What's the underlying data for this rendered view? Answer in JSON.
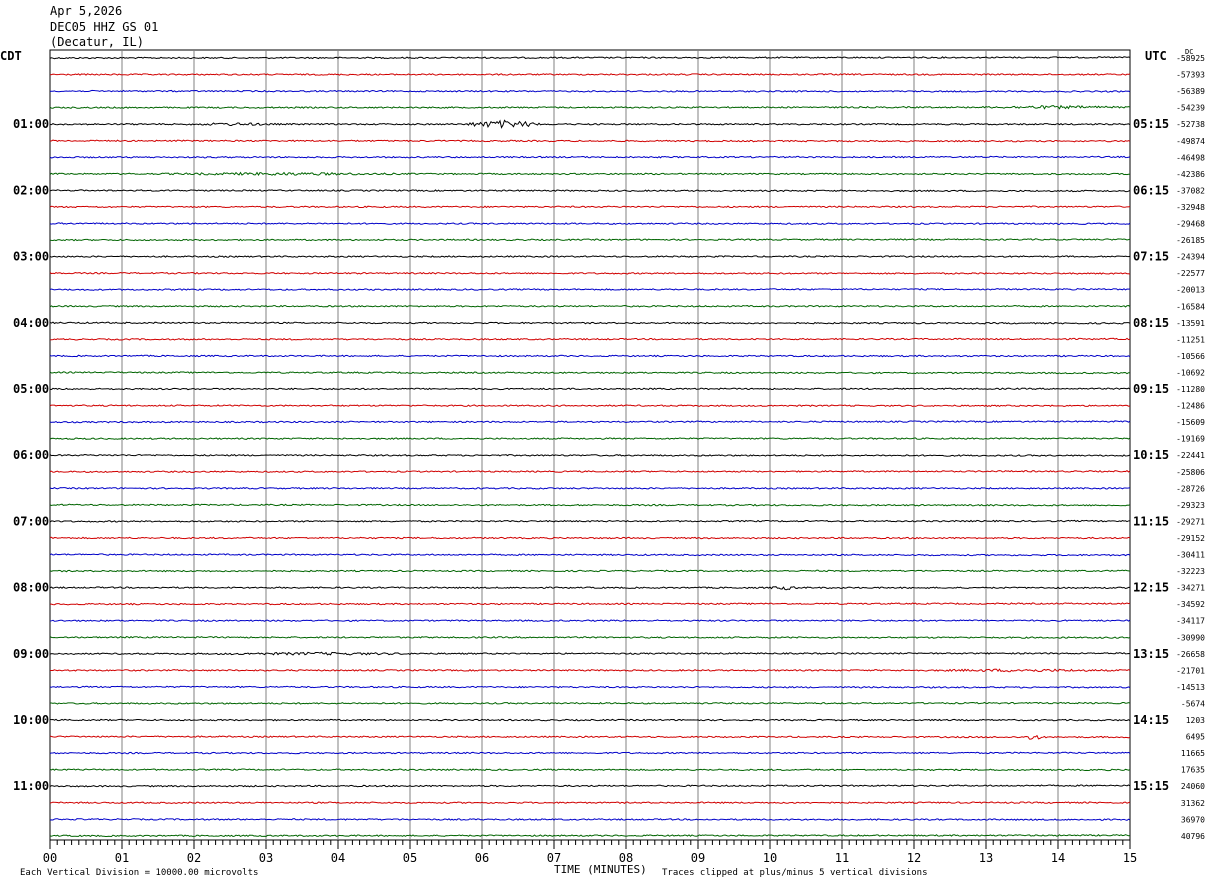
{
  "header": {
    "date": "Apr 5,2026",
    "station": "DEC05 HHZ GS 01",
    "location": "(Decatur, IL)"
  },
  "axis": {
    "left_tz": "CDT",
    "right_tz": "UTC",
    "dc_label": "DC",
    "xlabel": "TIME (MINUTES)",
    "footer_left": "Each Vertical Division = 10000.00 microvolts",
    "footer_right": "Traces clipped at plus/minus 5 vertical divisions"
  },
  "chart_data": {
    "type": "line",
    "title": "DEC05 HHZ GS 01",
    "xlabel": "TIME (MINUTES)",
    "xlim": [
      0,
      15
    ],
    "x_ticks": [
      "00",
      "01",
      "02",
      "03",
      "04",
      "05",
      "06",
      "07",
      "08",
      "09",
      "10",
      "11",
      "12",
      "13",
      "14",
      "15"
    ],
    "left_hour_labels": [
      {
        "row": 4,
        "label": "01:00"
      },
      {
        "row": 8,
        "label": "02:00"
      },
      {
        "row": 12,
        "label": "03:00"
      },
      {
        "row": 16,
        "label": "04:00"
      },
      {
        "row": 20,
        "label": "05:00"
      },
      {
        "row": 24,
        "label": "06:00"
      },
      {
        "row": 28,
        "label": "07:00"
      },
      {
        "row": 32,
        "label": "08:00"
      },
      {
        "row": 36,
        "label": "09:00"
      },
      {
        "row": 40,
        "label": "10:00"
      },
      {
        "row": 44,
        "label": "11:00"
      }
    ],
    "right_hour_labels": [
      {
        "row": 4,
        "label": "05:15"
      },
      {
        "row": 8,
        "label": "06:15"
      },
      {
        "row": 12,
        "label": "07:15"
      },
      {
        "row": 16,
        "label": "08:15"
      },
      {
        "row": 20,
        "label": "09:15"
      },
      {
        "row": 24,
        "label": "10:15"
      },
      {
        "row": 28,
        "label": "11:15"
      },
      {
        "row": 32,
        "label": "12:15"
      },
      {
        "row": 36,
        "label": "13:15"
      },
      {
        "row": 40,
        "label": "14:15"
      },
      {
        "row": 44,
        "label": "15:15"
      }
    ],
    "trace_colors": [
      "#000000",
      "#d00000",
      "#0000c8",
      "#006400"
    ],
    "dc_offsets": [
      "-58925",
      "-57393",
      "-56389",
      "-54239",
      "-52738",
      "-49874",
      "-46498",
      "-42386",
      "-37082",
      "-32948",
      "-29468",
      "-26185",
      "-24394",
      "-22577",
      "-20013",
      "-16584",
      "-13591",
      "-11251",
      "-10566",
      "-10692",
      "-11280",
      "-12486",
      "-15609",
      "-19169",
      "-22441",
      "-25806",
      "-28726",
      "-29323",
      "-29271",
      "-29152",
      "-30411",
      "-32223",
      "-34271",
      "-34592",
      "-34117",
      "-30990",
      "-26658",
      "-21701",
      "-14513",
      "-5674",
      "1203",
      "6495",
      "11665",
      "17635",
      "24060",
      "31362",
      "36970",
      "40796"
    ],
    "events": [
      {
        "row": 4,
        "start_min": 5.8,
        "end_min": 6.8,
        "amp": 4
      },
      {
        "row": 4,
        "start_min": 1.8,
        "end_min": 3.3,
        "amp": 1.6
      },
      {
        "row": 7,
        "start_min": 1.2,
        "end_min": 5.2,
        "amp": 1.6
      },
      {
        "row": 3,
        "start_min": 12.8,
        "end_min": 15,
        "amp": 1.7
      },
      {
        "row": 32,
        "start_min": 10.0,
        "end_min": 10.4,
        "amp": 2.2
      },
      {
        "row": 36,
        "start_min": 2.0,
        "end_min": 5.5,
        "amp": 1.5
      },
      {
        "row": 37,
        "start_min": 12.0,
        "end_min": 15,
        "amp": 1.6
      },
      {
        "row": 41,
        "start_min": 13.55,
        "end_min": 13.75,
        "amp": 4
      }
    ]
  }
}
